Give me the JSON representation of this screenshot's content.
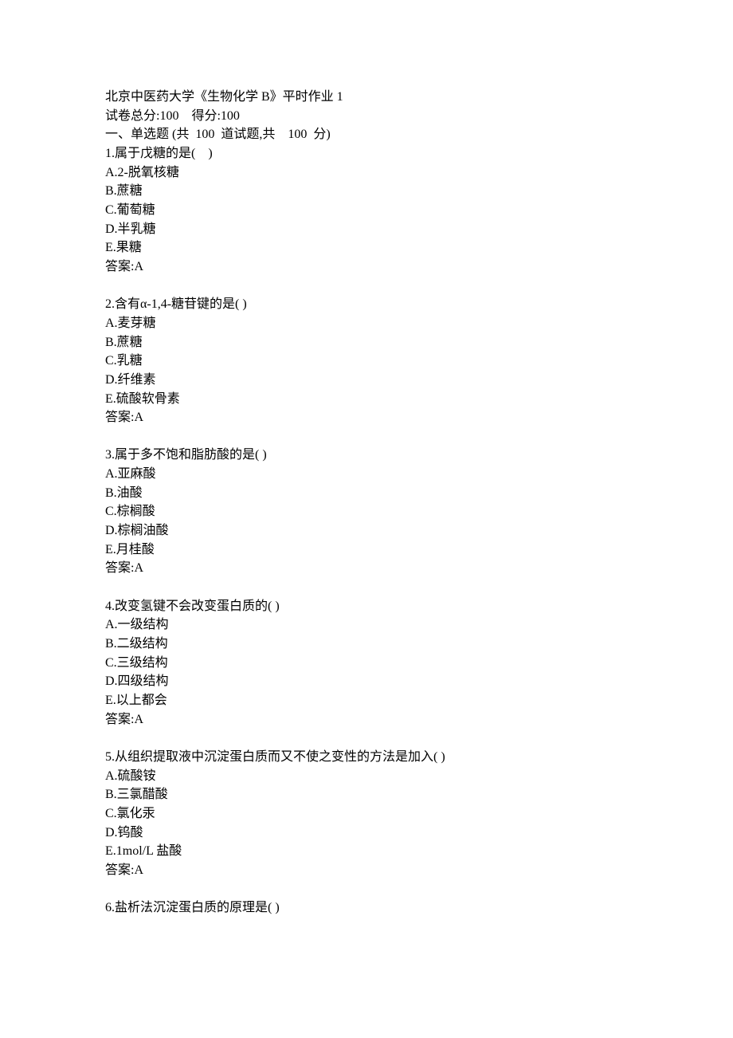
{
  "header": {
    "title": "北京中医药大学《生物化学 B》平时作业 1",
    "score_line": "试卷总分:100    得分:100",
    "section_title": "一、单选题 (共  100  道试题,共    100  分)"
  },
  "questions": [
    {
      "stem": "1.属于戊糖的是(    )",
      "options": [
        "A.2-脱氧核糖",
        "B.蔗糖",
        "C.葡萄糖",
        "D.半乳糖",
        "E.果糖"
      ],
      "answer": "答案:A"
    },
    {
      "stem": "2.含有α-1,4-糖苷键的是( )",
      "options": [
        "A.麦芽糖",
        "B.蔗糖",
        "C.乳糖",
        "D.纤维素",
        "E.硫酸软骨素"
      ],
      "answer": "答案:A"
    },
    {
      "stem": "3.属于多不饱和脂肪酸的是( )",
      "options": [
        "A.亚麻酸",
        "B.油酸",
        "C.棕榈酸",
        "D.棕榈油酸",
        "E.月桂酸"
      ],
      "answer": "答案:A"
    },
    {
      "stem": "4.改变氢键不会改变蛋白质的( )",
      "options": [
        "A.一级结构",
        "B.二级结构",
        "C.三级结构",
        "D.四级结构",
        "E.以上都会"
      ],
      "answer": "答案:A"
    },
    {
      "stem": "5.从组织提取液中沉淀蛋白质而又不使之变性的方法是加入( )",
      "options": [
        "A.硫酸铵",
        "B.三氯醋酸",
        "C.氯化汞",
        "D.钨酸",
        "E.1mol/L 盐酸"
      ],
      "answer": "答案:A"
    },
    {
      "stem": "6.盐析法沉淀蛋白质的原理是( )",
      "options": [],
      "answer": ""
    }
  ]
}
